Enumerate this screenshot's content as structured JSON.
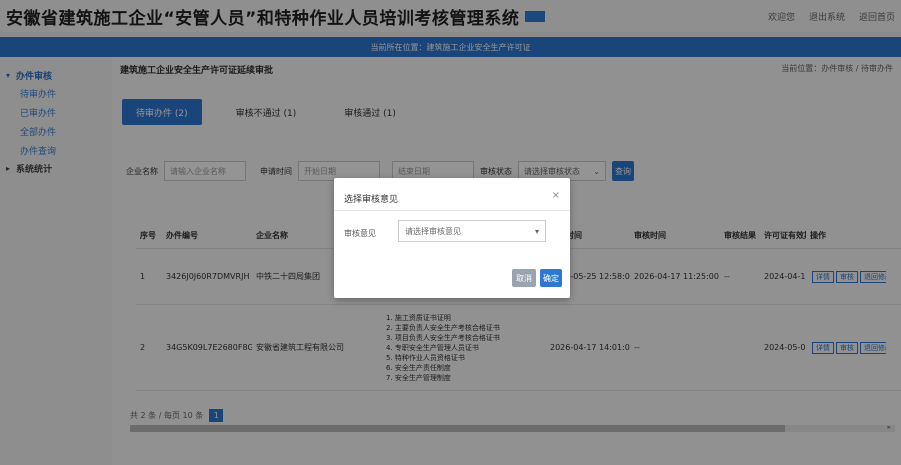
{
  "header": {
    "title": "安徽省建筑施工企业“安管人员”和特种作业人员培训考核管理系统",
    "right_links": [
      "欢迎您",
      "退出系统",
      "返回首页"
    ]
  },
  "banner": {
    "text": "当前所在位置：建筑施工企业安全生产许可证"
  },
  "sidebar": {
    "groups": [
      {
        "label": "办件审核",
        "items": [
          "待审办件",
          "已审办件",
          "全部办件",
          "办件查询"
        ]
      },
      {
        "label": "系统统计",
        "items": []
      }
    ]
  },
  "page": {
    "title": "建筑施工企业安全生产许可证延续审批",
    "right_text": "当前位置：办件审核 / 待审办件"
  },
  "tabs": [
    {
      "label": "待审办件 (2)"
    },
    {
      "label": "审核不通过 (1)"
    },
    {
      "label": "审核通过 (1)"
    }
  ],
  "filters": {
    "fields": [
      {
        "label": "企业名称",
        "placeholder": "请输入企业名称"
      },
      {
        "label": "申请时间",
        "placeholder": "开始日期"
      },
      {
        "label": "",
        "placeholder": "结束日期"
      }
    ],
    "select_label": "审核状态",
    "select_value": "请选择审核状态",
    "search_label": "查询"
  },
  "table": {
    "columns": [
      "序号",
      "办件编号",
      "企业名称",
      "",
      "申请时间",
      "审核时间",
      "审核结果",
      "许可证有效期",
      "操作"
    ],
    "rows": [
      {
        "no": "1",
        "code": "3426J0J60R7DMVRJH",
        "company": "中铁二十四局集团",
        "items": "",
        "apply_time": "2024-05-25 12:58:07",
        "review_time": "2026-04-17 11:25:00",
        "result": "--",
        "valid": "2024-04-17",
        "ops": [
          "详情",
          "审核",
          "退回修改"
        ]
      },
      {
        "no": "2",
        "code": "34G5K09L7E2680F8G1",
        "company": "安徽省建筑工程有限公司",
        "items": "1. 施工资质证书证明\n2. 主要负责人安全生产考核合格证书\n3. 项目负责人安全生产考核合格证书\n4. 专职安全生产管理人员证书\n5. 特种作业人员资格证书\n6. 安全生产责任制度\n7. 安全生产管理制度",
        "apply_time": "2026-04-17 14:01:09",
        "review_time": "--",
        "result": "",
        "valid": "2024-05-05",
        "ops": [
          "详情",
          "审核",
          "退回修改"
        ]
      }
    ]
  },
  "pager": {
    "text": "共 2 条 / 每页 10 条",
    "current_page": "1"
  },
  "modal": {
    "title": "选择审核意见",
    "close": "×",
    "field_label": "审核意见",
    "select_value": "请选择审核意见",
    "cancel_label": "取消",
    "ok_label": "确定"
  },
  "colors": {
    "primary": "#2e78d2",
    "overlay": "rgba(0,0,0,0.42)"
  }
}
